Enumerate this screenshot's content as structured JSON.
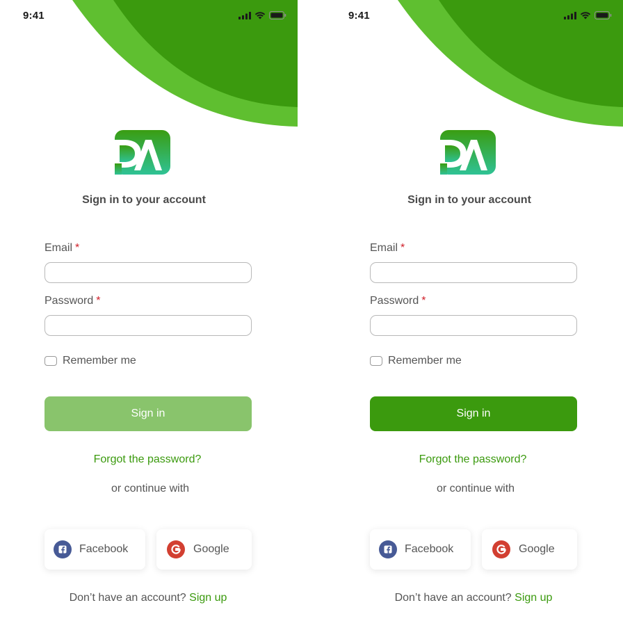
{
  "colors": {
    "brand_green": "#3b9a0e",
    "brand_green_light": "#5fbf30",
    "disabled_green": "#89c46c",
    "required_red": "#d0202a",
    "facebook_blue": "#475a96",
    "google_red": "#d23f31"
  },
  "screens": [
    {
      "state": "empty-form",
      "status": {
        "time": "9:41",
        "icons": [
          "signal-icon",
          "wifi-icon",
          "battery-icon"
        ]
      },
      "logo": {
        "text": "DA"
      },
      "heading": "Sign in to your account",
      "form": {
        "email_label": "Email",
        "password_label": "Password",
        "required_marker": "*",
        "email_value": "",
        "password_value": "",
        "remember_label": "Remember me",
        "remember_checked": false
      },
      "signin_label": "Sign in",
      "signin_enabled": false,
      "forgot_label": "Forgot the password?",
      "or_label": "or continue with",
      "social": {
        "facebook_label": "Facebook",
        "google_label": "Google"
      },
      "signup": {
        "prompt": "Don’t have an account?",
        "link": "Sign up"
      }
    },
    {
      "state": "enabled-button",
      "status": {
        "time": "9:41",
        "icons": [
          "signal-icon",
          "wifi-icon",
          "battery-icon"
        ]
      },
      "logo": {
        "text": "DA"
      },
      "heading": "Sign in to your account",
      "form": {
        "email_label": "Email",
        "password_label": "Password",
        "required_marker": "*",
        "email_value": "",
        "password_value": "",
        "remember_label": "Remember me",
        "remember_checked": false
      },
      "signin_label": "Sign in",
      "signin_enabled": true,
      "forgot_label": "Forgot the password?",
      "or_label": "or continue with",
      "social": {
        "facebook_label": "Facebook",
        "google_label": "Google"
      },
      "signup": {
        "prompt": "Don’t have an account?",
        "link": "Sign up"
      }
    }
  ]
}
